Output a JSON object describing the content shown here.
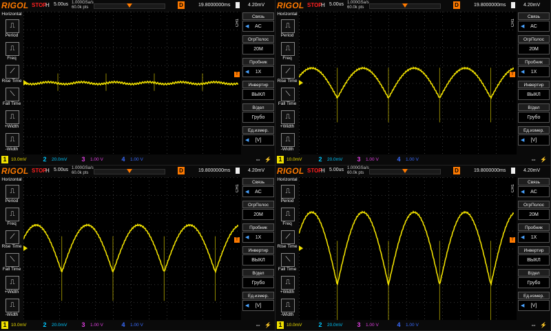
{
  "panels": [
    {
      "logo": "RIGOL",
      "run_state": "STOP",
      "h_label": "H",
      "h_scale": "5.00us",
      "sample_rate": "1.000GSa/s",
      "mem_depth": "60.0k pts",
      "d_label": "D",
      "delay": "19.8000000ms",
      "trig_level": "4.20mV",
      "menu_title": "Horizontal",
      "measure_items": [
        "Period",
        "Freq",
        "Rise Time",
        "Fall Time",
        "+Width",
        "-Width"
      ],
      "ch_tab": "CH1",
      "right_menu": [
        {
          "label": "Связь",
          "value": "AC"
        },
        {
          "label": "ОгрПолос",
          "value": "20M"
        },
        {
          "label": "Пробник",
          "value": "1X"
        },
        {
          "label": "Инвертир",
          "value": "ВЫКЛ"
        },
        {
          "label": "В/дел",
          "value": "Грубо"
        },
        {
          "label": "Ед.измер.",
          "value": "[V]"
        }
      ],
      "channels": [
        {
          "num": "1",
          "scale": "10.0mV"
        },
        {
          "num": "2",
          "scale": "20.0mV"
        },
        {
          "num": "3",
          "scale": "1.00 V"
        },
        {
          "num": "4",
          "scale": "1.00 V"
        }
      ],
      "waveform": {
        "type": "flat-noise",
        "amplitude": 0.03
      }
    },
    {
      "logo": "RIGOL",
      "run_state": "STOP",
      "h_label": "H",
      "h_scale": "5.00us",
      "sample_rate": "1.000GSa/s",
      "mem_depth": "60.0k pts",
      "d_label": "D",
      "delay": "19.8000000ms",
      "trig_level": "4.20mV",
      "menu_title": "Horizontal",
      "measure_items": [
        "Period",
        "Freq",
        "Rise Time",
        "Fall Time",
        "+Width",
        "-Width"
      ],
      "ch_tab": "CH1",
      "right_menu": [
        {
          "label": "Связь",
          "value": "AC"
        },
        {
          "label": "ОгрПолос",
          "value": "20M"
        },
        {
          "label": "Пробник",
          "value": "1X"
        },
        {
          "label": "Инвертир",
          "value": "ВЫКЛ"
        },
        {
          "label": "В/дел",
          "value": "Грубо"
        },
        {
          "label": "Ед.измер.",
          "value": "[V]"
        }
      ],
      "channels": [
        {
          "num": "1",
          "scale": "10.0mV"
        },
        {
          "num": "2",
          "scale": "20.0mV"
        },
        {
          "num": "3",
          "scale": "1.00 V"
        },
        {
          "num": "4",
          "scale": "1.00 V"
        }
      ],
      "waveform": {
        "type": "rectified",
        "amplitude": 0.35
      }
    },
    {
      "logo": "RIGOL",
      "run_state": "STOP",
      "h_label": "H",
      "h_scale": "5.00us",
      "sample_rate": "1.000GSa/s",
      "mem_depth": "60.0k pts",
      "d_label": "D",
      "delay": "19.8000000ms",
      "trig_level": "4.20mV",
      "menu_title": "Horizontal",
      "measure_items": [
        "Period",
        "Freq",
        "Rise Time",
        "Fall Time",
        "+Width",
        "-Width"
      ],
      "ch_tab": "CH1",
      "right_menu": [
        {
          "label": "Связь",
          "value": "AC"
        },
        {
          "label": "ОгрПолос",
          "value": "20M"
        },
        {
          "label": "Пробник",
          "value": "1X"
        },
        {
          "label": "Инвертир",
          "value": "ВЫКЛ"
        },
        {
          "label": "В/дел",
          "value": "Грубо"
        },
        {
          "label": "Ед.измер.",
          "value": "[V]"
        }
      ],
      "channels": [
        {
          "num": "1",
          "scale": "10.0mV"
        },
        {
          "num": "2",
          "scale": "20.0mV"
        },
        {
          "num": "3",
          "scale": "1.00 V"
        },
        {
          "num": "4",
          "scale": "1.00 V"
        }
      ],
      "waveform": {
        "type": "rectified",
        "amplitude": 0.55
      }
    },
    {
      "logo": "RIGOL",
      "run_state": "STOP",
      "h_label": "H",
      "h_scale": "5.00us",
      "sample_rate": "1.000GSa/s",
      "mem_depth": "60.0k pts",
      "d_label": "D",
      "delay": "19.8000000ms",
      "trig_level": "4.20mV",
      "menu_title": "Horizontal",
      "measure_items": [
        "Period",
        "Freq",
        "Rise Time",
        "Fall Time",
        "+Width",
        "-Width"
      ],
      "ch_tab": "CH1",
      "right_menu": [
        {
          "label": "Связь",
          "value": "AC"
        },
        {
          "label": "ОгрПолос",
          "value": "20M"
        },
        {
          "label": "Пробник",
          "value": "1X"
        },
        {
          "label": "Инвертир",
          "value": "ВЫКЛ"
        },
        {
          "label": "В/дел",
          "value": "Грубо"
        },
        {
          "label": "Ед.измер.",
          "value": "[V]"
        }
      ],
      "channels": [
        {
          "num": "1",
          "scale": "10.0mV"
        },
        {
          "num": "2",
          "scale": "20.0mV"
        },
        {
          "num": "3",
          "scale": "1.00 V"
        },
        {
          "num": "4",
          "scale": "1.00 V"
        }
      ],
      "waveform": {
        "type": "rectified",
        "amplitude": 0.85
      }
    }
  ],
  "colors": {
    "ch1": "#f0e000",
    "ch2": "#00c8ff",
    "ch3": "#e040e0",
    "ch4": "#3a6cff",
    "accent": "#ff7a00",
    "stop": "#ff2020",
    "grid": "#3a3a3a"
  },
  "icons": [
    "period-icon",
    "freq-icon",
    "rise-time-icon",
    "fall-time-icon",
    "pos-width-icon",
    "neg-width-icon",
    "usb-icon",
    "battery-icon"
  ]
}
